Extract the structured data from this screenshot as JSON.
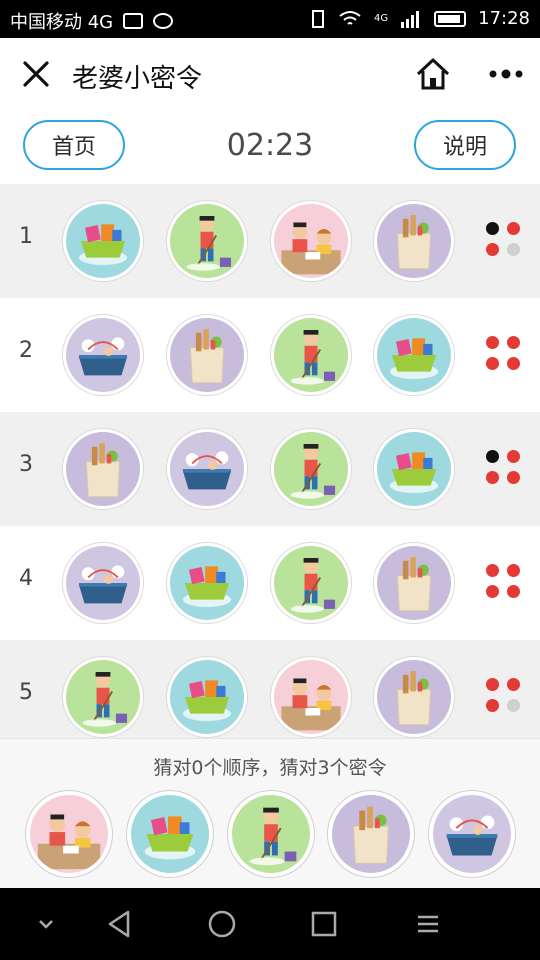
{
  "status_bar": {
    "carrier": "中国移动 4G",
    "time": "17:28",
    "network": "4G"
  },
  "navbar": {
    "title": "老婆小密令",
    "close_icon": "close-icon",
    "home_icon": "home-icon",
    "more_icon": "more-icon"
  },
  "toolbar": {
    "home_label": "首页",
    "timer": "02:23",
    "help_label": "说明"
  },
  "rows": [
    {
      "num": "1",
      "icons": [
        "laundry",
        "mopping",
        "homework",
        "groceries"
      ],
      "dots": [
        "black",
        "red",
        "red",
        "gray"
      ]
    },
    {
      "num": "2",
      "icons": [
        "dishes",
        "groceries",
        "mopping",
        "laundry"
      ],
      "dots": [
        "red",
        "red",
        "red",
        "red"
      ]
    },
    {
      "num": "3",
      "icons": [
        "groceries",
        "dishes",
        "mopping",
        "laundry"
      ],
      "dots": [
        "black",
        "red",
        "red",
        "red"
      ]
    },
    {
      "num": "4",
      "icons": [
        "dishes",
        "laundry",
        "mopping",
        "groceries"
      ],
      "dots": [
        "red",
        "red",
        "red",
        "red"
      ]
    },
    {
      "num": "5",
      "icons": [
        "mopping",
        "laundry",
        "homework",
        "groceries"
      ],
      "dots": [
        "red",
        "red",
        "red",
        "gray"
      ]
    }
  ],
  "bottom": {
    "hint": "猜对0个顺序，猜对3个密令",
    "choices": [
      "homework",
      "laundry",
      "mopping",
      "groceries",
      "dishes"
    ]
  },
  "system_nav": [
    "back-icon",
    "home-circle-icon",
    "recents-icon",
    "menu-icon"
  ],
  "colors": {
    "accent": "#2aa6dd",
    "dot_red": "#e53935",
    "dot_black": "#111111",
    "dot_gray": "#d0d0d0",
    "bg_laundry": "#9fd9e0",
    "bg_mopping": "#b9e29a",
    "bg_homework": "#f6cfd9",
    "bg_groceries": "#c7bcdc",
    "bg_dishes": "#cfc6e2"
  }
}
